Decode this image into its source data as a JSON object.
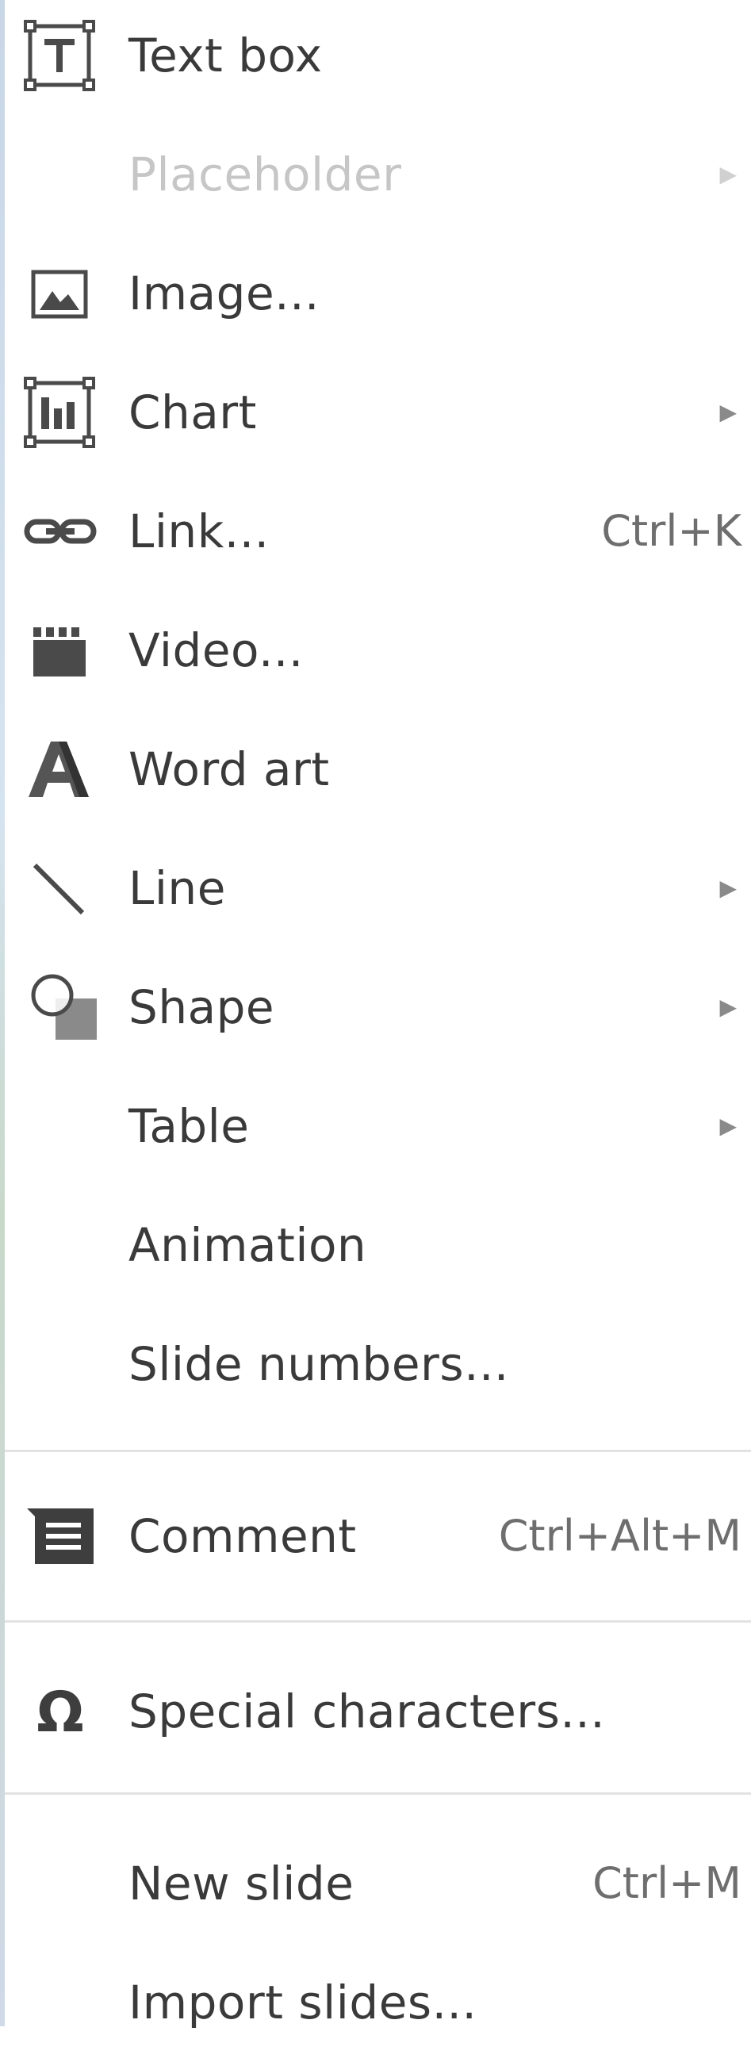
{
  "menu": {
    "items": [
      {
        "label": "Text box",
        "icon": "text-box-icon"
      },
      {
        "label": "Placeholder",
        "icon": "",
        "submenu_indicator": "▶",
        "disabled": true
      },
      {
        "label": "Image...",
        "icon": "image-icon"
      },
      {
        "label": "Chart",
        "icon": "chart-icon",
        "submenu_indicator": "▶"
      },
      {
        "label": "Link...",
        "icon": "link-icon",
        "shortcut": "Ctrl+K"
      },
      {
        "label": "Video...",
        "icon": "video-icon"
      },
      {
        "label": "Word art",
        "icon": "word-art-icon"
      },
      {
        "label": "Line",
        "icon": "line-icon",
        "submenu_indicator": "▶"
      },
      {
        "label": "Shape",
        "icon": "shape-icon",
        "submenu_indicator": "▶"
      },
      {
        "label": "Table",
        "icon": "",
        "submenu_indicator": "▶"
      },
      {
        "label": "Animation",
        "icon": ""
      },
      {
        "label": "Slide numbers...",
        "icon": ""
      },
      {
        "label": "Comment",
        "icon": "comment-icon",
        "shortcut": "Ctrl+Alt+M"
      },
      {
        "label": "Special characters...",
        "icon": "omega-icon"
      },
      {
        "label": "New slide",
        "icon": "",
        "shortcut": "Ctrl+M"
      },
      {
        "label": "Import slides...",
        "icon": ""
      }
    ]
  },
  "colors": {
    "text": "#3a3a3a",
    "disabled_text": "#c6c6c6",
    "icon": "#4a4a4a",
    "separator": "#e2e2e2"
  }
}
